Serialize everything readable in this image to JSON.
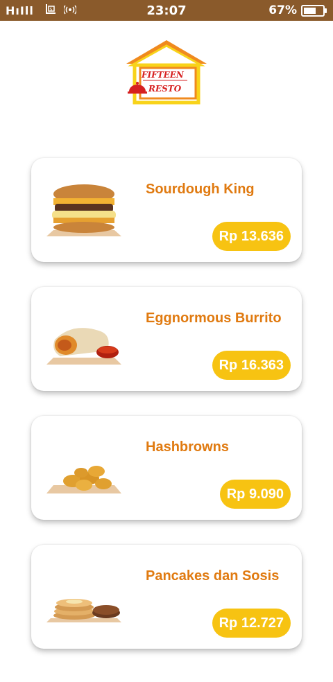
{
  "status_bar": {
    "signal_text": "HıIll",
    "time": "23:07",
    "battery_percent": "67%",
    "battery_level": 0.67
  },
  "brand": {
    "line1": "FIFTEEN",
    "line2": "RESTO"
  },
  "menu": [
    {
      "name": "Sourdough King",
      "price": "Rp 13.636",
      "image": "burger"
    },
    {
      "name": "Eggnormous Burrito",
      "price": "Rp 16.363",
      "image": "burrito"
    },
    {
      "name": "Hashbrowns",
      "price": "Rp 9.090",
      "image": "hashbrowns"
    },
    {
      "name": "Pancakes dan Sosis",
      "price": "Rp 12.727",
      "image": "pancakes"
    }
  ],
  "colors": {
    "status_bar": "#8a5a2b",
    "title_text": "#e07a10",
    "price_badge": "#f7c312",
    "logo_red": "#d62020",
    "logo_orange": "#f08a1e",
    "logo_yellow": "#f8d31a"
  }
}
